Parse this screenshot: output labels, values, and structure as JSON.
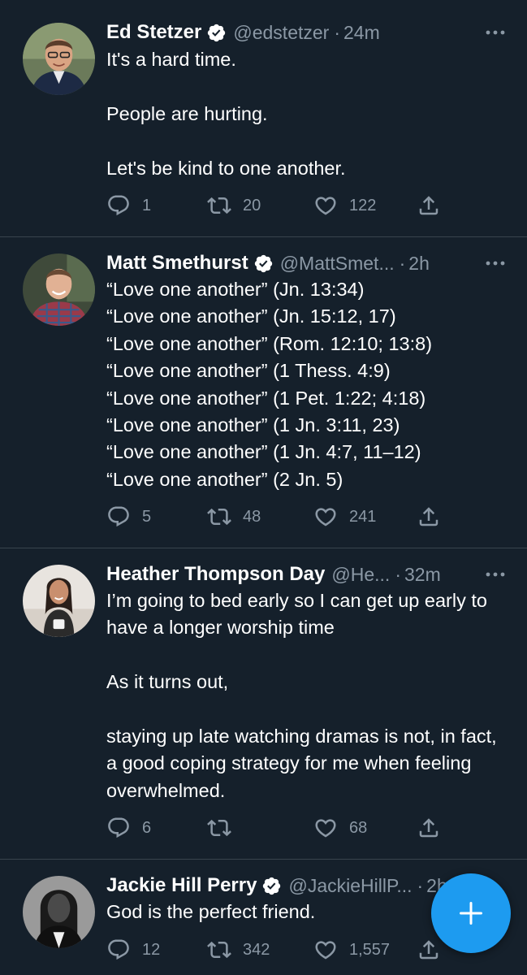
{
  "colors": {
    "background": "#15202b",
    "divider": "#38444d",
    "text_primary": "#ffffff",
    "text_secondary": "#8b98a5",
    "accent": "#1d9bf0"
  },
  "tweets": [
    {
      "name": "Ed Stetzer",
      "verified": true,
      "handle": "@edstetzer",
      "time": "24m",
      "text": "It's a hard time.\n\nPeople are hurting.\n\nLet's be kind to one another.",
      "replies": "1",
      "retweets": "20",
      "likes": "122"
    },
    {
      "name": "Matt Smethurst",
      "verified": true,
      "handle": "@MattSmet...",
      "time": "2h",
      "text": "“Love one another” (Jn. 13:34)\n“Love one another” (Jn. 15:12, 17)\n“Love one another” (Rom. 12:10; 13:8)\n“Love one another” (1 Thess. 4:9)\n“Love one another” (1 Pet. 1:22; 4:18)\n“Love one another” (1 Jn. 3:11, 23)\n“Love one another” (1 Jn. 4:7, 11–12)\n“Love one another” (2 Jn. 5)",
      "replies": "5",
      "retweets": "48",
      "likes": "241"
    },
    {
      "name": "Heather Thompson Day",
      "verified": false,
      "handle": "@He...",
      "time": "32m",
      "text": "I’m going to bed early so I can get up early to have a longer worship time\n\nAs it turns out,\n\nstaying up late watching dramas is not, in fact, a good coping strategy for me when feeling overwhelmed.",
      "replies": "6",
      "retweets": "",
      "likes": "68"
    },
    {
      "name": "Jackie Hill Perry",
      "verified": true,
      "handle": "@JackieHillP...",
      "time": "2h",
      "text": "God is the perfect friend.",
      "replies": "12",
      "retweets": "342",
      "likes": "1,557"
    }
  ],
  "icons": {
    "verified": "verified-badge-icon",
    "more": "more-dots-icon",
    "reply": "reply-bubble-icon",
    "retweet": "retweet-arrows-icon",
    "like": "heart-icon",
    "share": "share-upload-icon",
    "compose": "plus-icon"
  }
}
